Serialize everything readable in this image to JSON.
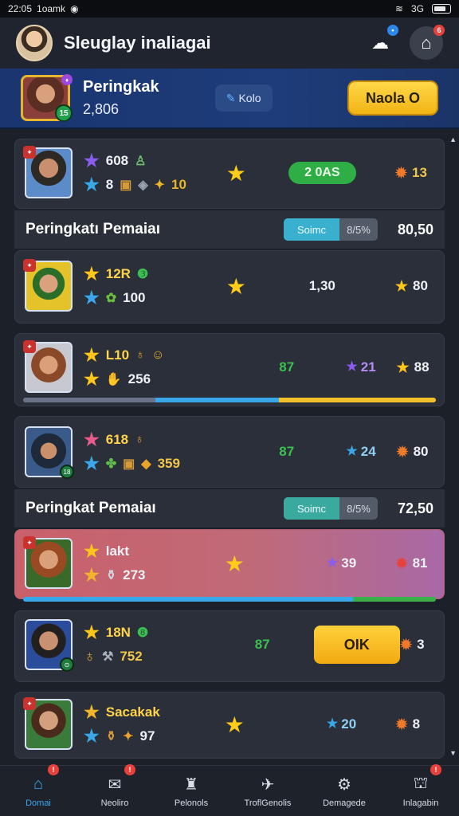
{
  "status_bar": {
    "time": "22:05",
    "carrier": "1oamk",
    "network": "3G"
  },
  "header": {
    "title": "Sleuglay inaliagai",
    "cloud_badge": "•",
    "shop_badge": "6"
  },
  "profile": {
    "title": "Peringkak",
    "score": "2,806",
    "level": "15",
    "kota_label": "Kolo",
    "action_label": "Naola O"
  },
  "rows": {
    "r1": {
      "stat1": "608",
      "stat2": "8",
      "stat3": "10",
      "pill": "2 0AS",
      "right": "13"
    },
    "r2": {
      "stat1": "12R",
      "stat2": "100",
      "col_a": "1,30",
      "right": "80"
    },
    "r3": {
      "stat1": "L10",
      "stat2": "256",
      "col_a": "87",
      "col_a2": "21",
      "right": "88"
    },
    "r4": {
      "stat1": "618",
      "stat2": "359",
      "col_a": "87",
      "col_a2": "24",
      "right": "80"
    },
    "r5": {
      "stat1": "lakt",
      "stat2": "273",
      "col_a2": "39",
      "right": "81"
    },
    "r6": {
      "stat1": "18N",
      "stat2": "752",
      "col_a": "87",
      "ok_label": "OIK",
      "right": "3"
    },
    "r7": {
      "stat1": "Sacakak",
      "stat2": "97",
      "col_a2": "20",
      "right": "8"
    }
  },
  "sections": [
    {
      "title": "Peringkatı Pemaiaı",
      "seg1": "Soimc",
      "seg2": "8/5%",
      "value": "80,50"
    },
    {
      "title": "Peringkat Pemaiaı",
      "seg1": "Soimc",
      "seg2": "8/5%",
      "value": "72,50"
    }
  ],
  "nav": [
    {
      "label": "Domai",
      "icon": "home-icon"
    },
    {
      "label": "Neoliro",
      "icon": "chat-icon"
    },
    {
      "label": "Pelonols",
      "icon": "trophy-icon"
    },
    {
      "label": "TroflGenolis",
      "icon": "mail-icon"
    },
    {
      "label": "Demagede",
      "icon": "settings-icon"
    },
    {
      "label": "Inlagabin",
      "icon": "store-icon"
    }
  ],
  "colors": {
    "accent_gold": "#ffc61a",
    "accent_blue": "#3aa8f0",
    "banner_blue": "#1e3c7a",
    "highlight_row": "#c06a78"
  }
}
